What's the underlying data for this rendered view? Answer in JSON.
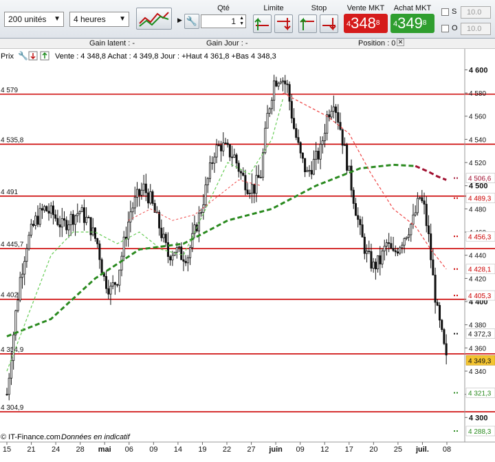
{
  "toolbar": {
    "units_select": "200 unités",
    "period_select": "4 heures",
    "chart_type_icon": "candlestick-chart-icon",
    "qty_label": "Qté",
    "qty_value": "1",
    "limit_label": "Limite",
    "stop_label": "Stop",
    "sell_label": "Vente MKT",
    "buy_label": "Achat MKT",
    "sell_prefix": "4",
    "sell_main": "348",
    "sell_suffix": "8",
    "buy_prefix": "4",
    "buy_main": "349",
    "buy_suffix": "8",
    "s_label": "S",
    "o_label": "O",
    "s_value": "10.0",
    "o_value": "10.0"
  },
  "infobar": {
    "gain_latent": "Gain latent : -",
    "gain_jour": "Gain Jour : -",
    "position": "Position : 0"
  },
  "chart_header": "Vente : 4 348,8 Achat : 4 349,8 Jour : +Haut 4 361,8 +Bas 4 348,3",
  "price_label": "Prix",
  "watermark": "© IT-Finance.com",
  "watermark_note": "Données en indicatif",
  "colors": {
    "hline": "#cc0000",
    "ma_long": "#2a8a1f",
    "ma_short": "#66cc55",
    "ma_red": "#ee4444",
    "ma_darkred": "#a01030",
    "current": "#f4c430"
  },
  "chart_data": {
    "type": "candlestick",
    "ylim": [
      4288.3,
      4605
    ],
    "yticks": [
      4300,
      4320,
      4340,
      4360,
      4380,
      4400,
      4420,
      4440,
      4460,
      4480,
      4500,
      4520,
      4540,
      4560,
      4580,
      4600
    ],
    "bold_yticks": [
      4300,
      4400,
      4500,
      4600
    ],
    "x_ticks": [
      {
        "label": "15",
        "bold": false
      },
      {
        "label": "21",
        "bold": false
      },
      {
        "label": "24",
        "bold": false
      },
      {
        "label": "28",
        "bold": false
      },
      {
        "label": "mai",
        "bold": true
      },
      {
        "label": "06",
        "bold": false
      },
      {
        "label": "09",
        "bold": false
      },
      {
        "label": "14",
        "bold": false
      },
      {
        "label": "19",
        "bold": false
      },
      {
        "label": "22",
        "bold": false
      },
      {
        "label": "27",
        "bold": false
      },
      {
        "label": "juin",
        "bold": true
      },
      {
        "label": "09",
        "bold": false
      },
      {
        "label": "12",
        "bold": false
      },
      {
        "label": "17",
        "bold": false
      },
      {
        "label": "20",
        "bold": false
      },
      {
        "label": "25",
        "bold": false
      },
      {
        "label": "juil.",
        "bold": true
      },
      {
        "label": "08",
        "bold": false
      }
    ],
    "horizontal_lines": [
      {
        "value": 4579,
        "label": "4 579"
      },
      {
        "value": 4535.8,
        "label": "4 535,8"
      },
      {
        "value": 4491,
        "label": "4 491"
      },
      {
        "value": 4445.7,
        "label": "4 445,7"
      },
      {
        "value": 4402,
        "label": "4 402"
      },
      {
        "value": 4354.9,
        "label": "4 354,9"
      },
      {
        "value": 4304.9,
        "label": "4 304,9"
      }
    ],
    "right_markers": [
      {
        "value": 4506.6,
        "label": "4 506,6",
        "color": "#a01030"
      },
      {
        "value": 4489.3,
        "label": "4 489,3",
        "color": "#cc0000"
      },
      {
        "value": 4456.3,
        "label": "4 456,3",
        "color": "#cc0000"
      },
      {
        "value": 4428.1,
        "label": "4 428,1",
        "color": "#cc0000"
      },
      {
        "value": 4405.3,
        "label": "4 405,3",
        "color": "#cc0000"
      },
      {
        "value": 4372.3,
        "label": "4 372,3",
        "color": "#111111"
      },
      {
        "value": 4321.3,
        "label": "4 321,3",
        "color": "#2a8a1f"
      },
      {
        "value": 4288.3,
        "label": "4 288,3",
        "color": "#2a8a1f"
      }
    ],
    "current_price": {
      "value": 4349.3,
      "label": "4 349,3"
    },
    "close_path": [
      [
        0,
        4320
      ],
      [
        2,
        4355
      ],
      [
        4,
        4390
      ],
      [
        6,
        4420
      ],
      [
        9,
        4450
      ],
      [
        13,
        4470
      ],
      [
        17,
        4480
      ],
      [
        21,
        4475
      ],
      [
        25,
        4465
      ],
      [
        29,
        4472
      ],
      [
        33,
        4478
      ],
      [
        37,
        4468
      ],
      [
        41,
        4450
      ],
      [
        44,
        4420
      ],
      [
        47,
        4410
      ],
      [
        50,
        4420
      ],
      [
        53,
        4450
      ],
      [
        56,
        4478
      ],
      [
        59,
        4490
      ],
      [
        62,
        4498
      ],
      [
        65,
        4488
      ],
      [
        69,
        4465
      ],
      [
        73,
        4440
      ],
      [
        76,
        4445
      ],
      [
        79,
        4440
      ],
      [
        82,
        4440
      ],
      [
        85,
        4460
      ],
      [
        88,
        4480
      ],
      [
        91,
        4505
      ],
      [
        94,
        4530
      ],
      [
        97,
        4535
      ],
      [
        100,
        4530
      ],
      [
        103,
        4525
      ],
      [
        106,
        4510
      ],
      [
        109,
        4500
      ],
      [
        112,
        4498
      ],
      [
        115,
        4510
      ],
      [
        118,
        4560
      ],
      [
        121,
        4590
      ],
      [
        124,
        4595
      ],
      [
        127,
        4585
      ],
      [
        130,
        4550
      ],
      [
        133,
        4525
      ],
      [
        136,
        4510
      ],
      [
        139,
        4520
      ],
      [
        142,
        4530
      ],
      [
        145,
        4560
      ],
      [
        148,
        4575
      ],
      [
        151,
        4550
      ],
      [
        154,
        4520
      ],
      [
        157,
        4490
      ],
      [
        160,
        4460
      ],
      [
        163,
        4440
      ],
      [
        166,
        4430
      ],
      [
        169,
        4435
      ],
      [
        172,
        4450
      ],
      [
        175,
        4440
      ],
      [
        178,
        4450
      ],
      [
        181,
        4460
      ],
      [
        184,
        4470
      ],
      [
        187,
        4490
      ],
      [
        189,
        4480
      ],
      [
        191,
        4455
      ],
      [
        193,
        4420
      ],
      [
        195,
        4390
      ],
      [
        197,
        4370
      ],
      [
        199,
        4349
      ]
    ],
    "ma_long": [
      [
        0,
        4370
      ],
      [
        20,
        4385
      ],
      [
        40,
        4420
      ],
      [
        60,
        4445
      ],
      [
        80,
        4450
      ],
      [
        100,
        4470
      ],
      [
        120,
        4480
      ],
      [
        140,
        4500
      ],
      [
        160,
        4515
      ],
      [
        175,
        4518
      ],
      [
        185,
        4517
      ],
      [
        191,
        4512
      ],
      [
        195,
        4508
      ],
      [
        199,
        4505
      ]
    ],
    "ma_short_green": [
      [
        0,
        4340
      ],
      [
        10,
        4390
      ],
      [
        20,
        4440
      ],
      [
        30,
        4460
      ],
      [
        40,
        4460
      ],
      [
        50,
        4450
      ],
      [
        60,
        4460
      ],
      [
        70,
        4445
      ],
      [
        80,
        4440
      ],
      [
        90,
        4480
      ],
      [
        100,
        4520
      ],
      [
        110,
        4510
      ],
      [
        120,
        4540
      ],
      [
        125,
        4575
      ]
    ],
    "ma_short_red": [
      [
        125,
        4580
      ],
      [
        135,
        4570
      ],
      [
        145,
        4560
      ],
      [
        155,
        4545
      ],
      [
        165,
        4510
      ],
      [
        175,
        4480
      ],
      [
        185,
        4465
      ],
      [
        192,
        4445
      ],
      [
        199,
        4428
      ]
    ],
    "ma_short_red_early": [
      [
        55,
        4470
      ],
      [
        65,
        4480
      ],
      [
        75,
        4470
      ],
      [
        85,
        4475
      ],
      [
        95,
        4490
      ],
      [
        105,
        4505
      ],
      [
        115,
        4500
      ]
    ],
    "x_max": 203
  }
}
